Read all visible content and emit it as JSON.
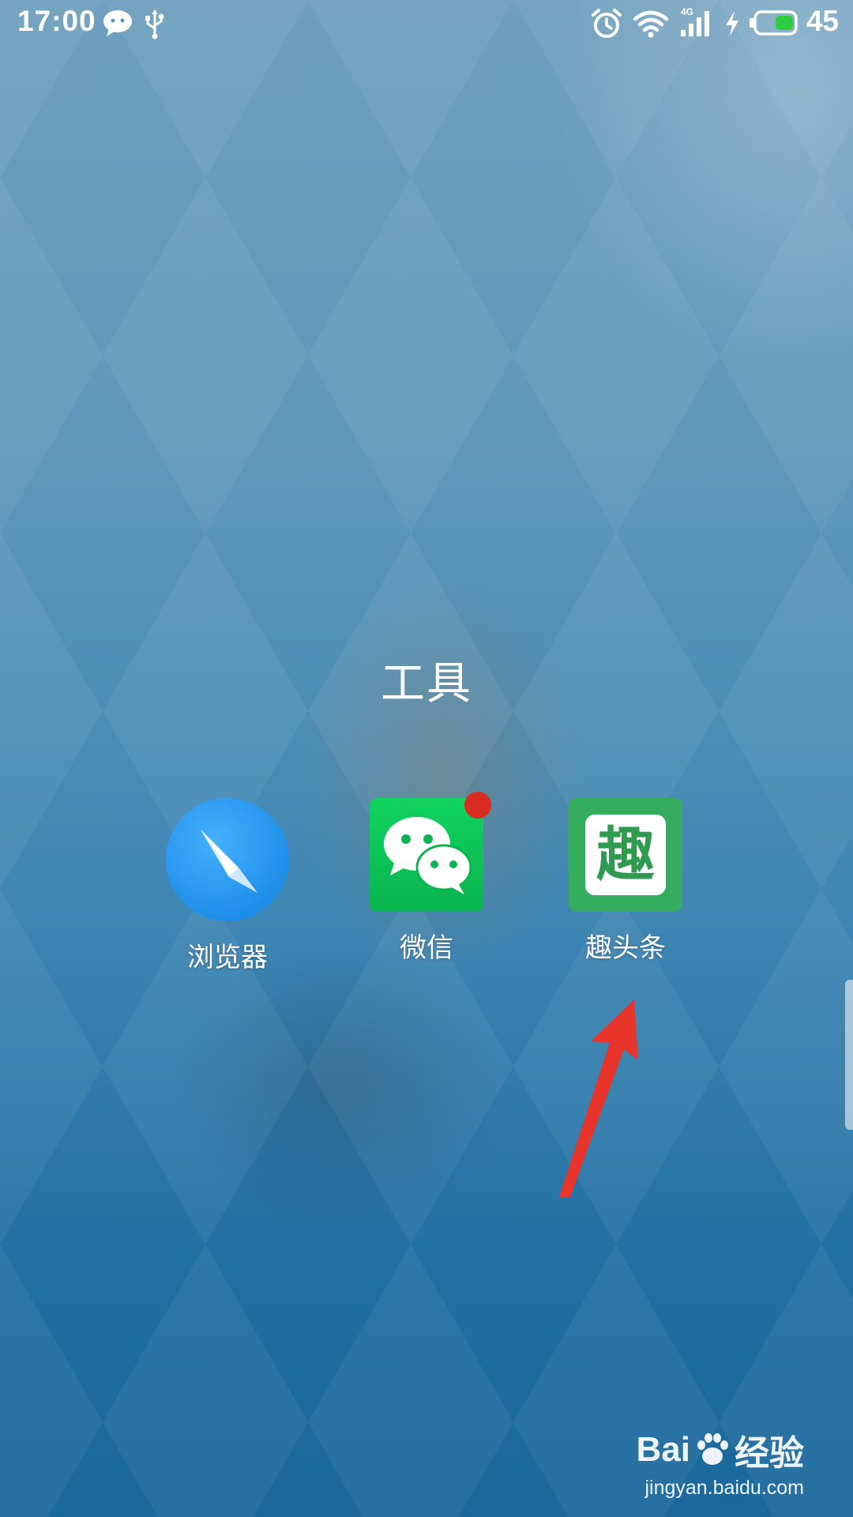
{
  "status_bar": {
    "time": "17:00",
    "left_icons": [
      "chat-bubble-icon",
      "usb-icon"
    ],
    "right_icons": [
      "alarm-icon",
      "wifi-icon",
      "signal-4g-icon",
      "charging-icon",
      "battery-icon"
    ],
    "network_label": "4G",
    "battery_percent": "45",
    "battery_color": "#2ecc40"
  },
  "folder": {
    "title": "工具",
    "apps": [
      {
        "label": "浏览器",
        "icon": "compass-icon",
        "color": "#1e8fe8",
        "badge": false
      },
      {
        "label": "微信",
        "icon": "wechat-icon",
        "color": "#0ab44f",
        "badge": true
      },
      {
        "label": "趣头条",
        "icon": "qutoutiao-icon",
        "icon_text": "趣",
        "color": "#35ad5f",
        "badge": false
      }
    ]
  },
  "annotation": {
    "type": "arrow",
    "color": "#e8342a",
    "points_to": "趣头条"
  },
  "watermark": {
    "brand_left": "Bai",
    "brand_right": "经验",
    "url": "jingyan.baidu.com"
  }
}
